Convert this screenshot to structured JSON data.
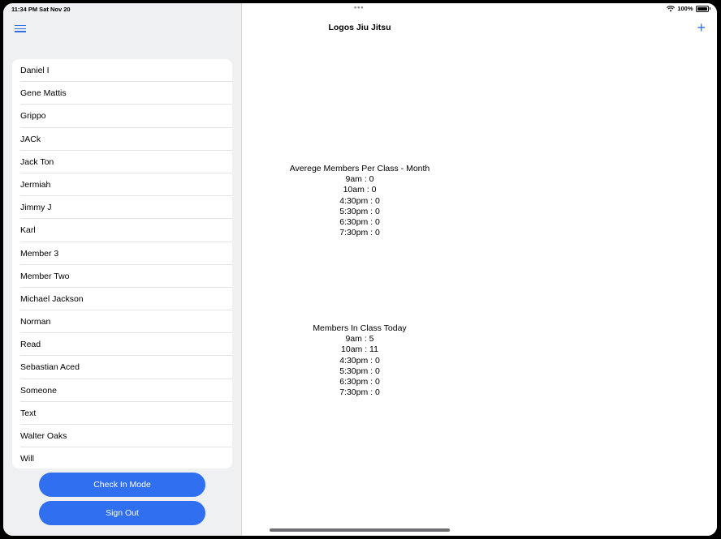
{
  "status_bar": {
    "time": "11:34 PM  Sat Nov 20",
    "dots": "•••",
    "battery": "100%"
  },
  "sidebar": {
    "members": [
      "Daniel I",
      "Gene Mattis",
      "Grippo",
      "JACk",
      "Jack Ton",
      "Jermiah",
      "Jimmy J",
      "Karl",
      "Member 3",
      "Member Two",
      "Michael Jackson",
      "Norman",
      "Read",
      "Sebastian Aced",
      "Someone",
      "Text",
      "Walter Oaks",
      "Will"
    ],
    "check_in_label": "Check In Mode",
    "sign_out_label": "Sign Out"
  },
  "main": {
    "title": "Logos Jiu Jitsu",
    "add_symbol": "+",
    "average_section": {
      "title": "Averege Members Per Class - Month",
      "lines": [
        "9am : 0",
        "10am : 0",
        "4:30pm : 0",
        "5:30pm : 0",
        "6:30pm : 0",
        "7:30pm : 0"
      ]
    },
    "today_section": {
      "title": "Members In Class Today",
      "lines": [
        "9am : 5",
        "10am : 11",
        "4:30pm : 0",
        "5:30pm : 0",
        "6:30pm : 0",
        "7:30pm : 0"
      ]
    }
  },
  "colors": {
    "accent": "#2f6ff0",
    "sidebar_bg": "#eef0f2"
  }
}
